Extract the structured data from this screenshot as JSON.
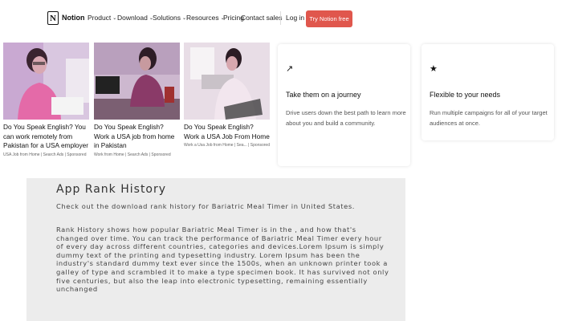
{
  "nav": {
    "brand": "Notion",
    "logo_letter": "N",
    "menu": [
      {
        "label": "Product",
        "has_dropdown": true
      },
      {
        "label": "Download",
        "has_dropdown": true
      },
      {
        "label": "Solutions",
        "has_dropdown": true
      },
      {
        "label": "Resources",
        "has_dropdown": true
      },
      {
        "label": "Pricing",
        "has_dropdown": false
      }
    ],
    "contact_sales": "Contact sales",
    "login": "Log in",
    "cta": "Try Notion free",
    "cta_color": "#e0574d"
  },
  "ads": [
    {
      "headline": "Do You Speak English? You can work remotely from Pakistan for a USA employer",
      "source": "USA Job from Home | Search Ads | Sponsored"
    },
    {
      "headline": "Do You Speak English? Work a USA job from home in Pakistan",
      "source": "Work from Home | Search Ads | Sponsored"
    },
    {
      "headline": "Do You Speak English? Work a USA Job From Home",
      "source": "Work a Usa Job from Home | Sea... | Sponsored"
    }
  ],
  "cards": [
    {
      "icon": "journey-arrow-icon",
      "glyph": "↗",
      "title": "Take them on a journey",
      "desc": "Drive users down the best path to learn more about you and build a community."
    },
    {
      "icon": "star-icon",
      "glyph": "★",
      "title": "Flexible to your needs",
      "desc": "Run multiple campaigns for all of your target audiences at once."
    }
  ],
  "rank": {
    "title": "App Rank History",
    "intro": "Check out the download rank history for Bariatric Meal Timer in United States.",
    "body": "Rank History shows how popular Bariatric Meal Timer is in the , and how that's changed over time. You can track the performance of Bariatric Meal Timer every hour of every day across different countries, categories and devices.Lorem Ipsum is simply dummy text of the printing and typesetting industry. Lorem Ipsum has been the industry's standard dummy text ever since the 1500s, when an unknown printer took a galley of type and scrambled it to make a type specimen book. It has survived not only five centuries, but also the leap into electronic typesetting, remaining essentially unchanged"
  }
}
